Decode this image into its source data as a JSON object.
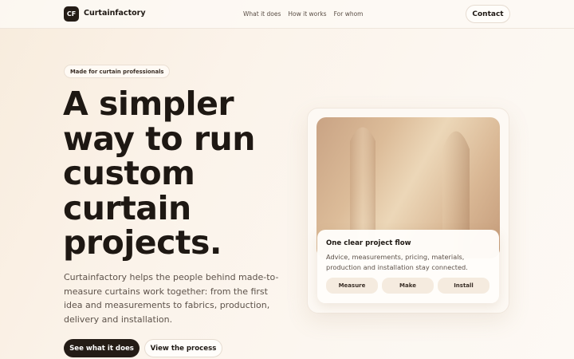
{
  "nav": {
    "logo_mark": "CF",
    "brand": "Curtainfactory",
    "links": [
      "What it does",
      "How it works",
      "For whom"
    ],
    "contact_label": "Contact"
  },
  "hero": {
    "eyebrow": "Made for curtain professionals",
    "headline_lines": [
      "A simpler",
      "way to run",
      "custom",
      "curtain",
      "projects."
    ],
    "lede": "Curtainfactory helps the people behind made-to-measure curtains work together: from the first idea and measurements to fabrics, production, delivery and installation.",
    "primary_cta": "See what it does",
    "secondary_cta": "View the process"
  },
  "card": {
    "title": "One clear project flow",
    "description": "Advice, measurements, pricing, materials, production and installation stay connected.",
    "steps": [
      "Measure",
      "Make",
      "Install"
    ]
  },
  "colors": {
    "dark": "#241c16",
    "accent_soft": "#f5ebdf",
    "text_muted": "#5d524a"
  }
}
